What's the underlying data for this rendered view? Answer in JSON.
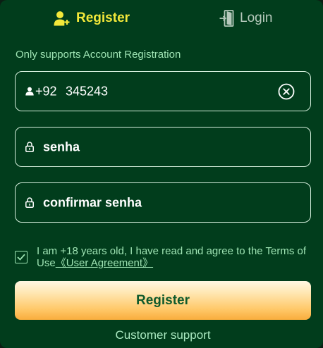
{
  "tabs": {
    "register_label": "Register",
    "login_label": "Login",
    "active": "register"
  },
  "form": {
    "hint": "Only supports Account Registration",
    "phone": {
      "country_code": "+92",
      "value": "345243"
    },
    "password": {
      "value": "senha"
    },
    "confirm_password": {
      "value": "confirmar senha"
    },
    "agreement": {
      "checked": true,
      "text": "I am +18 years old, I have read and agree to the Terms of Use",
      "link_text": "《User Agreement》"
    },
    "submit_label": "Register",
    "support_label": "Customer support"
  },
  "colors": {
    "background": "#013d1c",
    "active_tab": "#f3e83a",
    "accent_text": "#9ee3b3",
    "button_gradient_top": "#fff8e3",
    "button_gradient_bottom": "#f9ad3d",
    "button_text": "#0f5a2c"
  },
  "icons": {
    "register_tab": "add-user-icon",
    "login_tab": "login-door-icon",
    "phone_field": "user-icon",
    "password_field": "lock-icon",
    "clear": "clear-circle-icon",
    "checkbox": "checkmark-icon"
  }
}
